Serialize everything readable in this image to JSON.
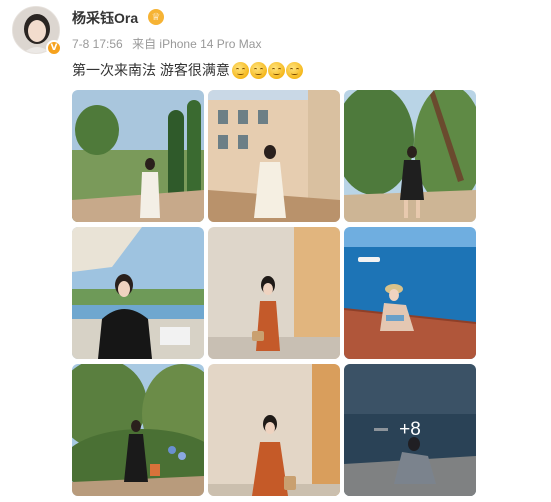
{
  "post": {
    "author_name": "杨采钰Ora",
    "verified_badge": "V",
    "member_icon": "crown-icon",
    "timestamp": "7-8 17:56",
    "source": "来自 iPhone 14 Pro Max",
    "text": "第一次来南法 游客很满意",
    "emoji_count": 4
  },
  "photos": [
    {
      "label": "garden-cypress-white-dress"
    },
    {
      "label": "town-street-white-dress"
    },
    {
      "label": "garden-path-black-top"
    },
    {
      "label": "terrace-restaurant-black-top"
    },
    {
      "label": "stone-wall-orange-dress"
    },
    {
      "label": "boat-deck-sea"
    },
    {
      "label": "garden-flowers-black-dress"
    },
    {
      "label": "ochre-wall-orange-dress"
    },
    {
      "label": "boat-sunset-more"
    }
  ],
  "more_count_label": "+8",
  "colors": {
    "name": "#333333",
    "meta": "#999999",
    "badge": "#f6a21e"
  }
}
